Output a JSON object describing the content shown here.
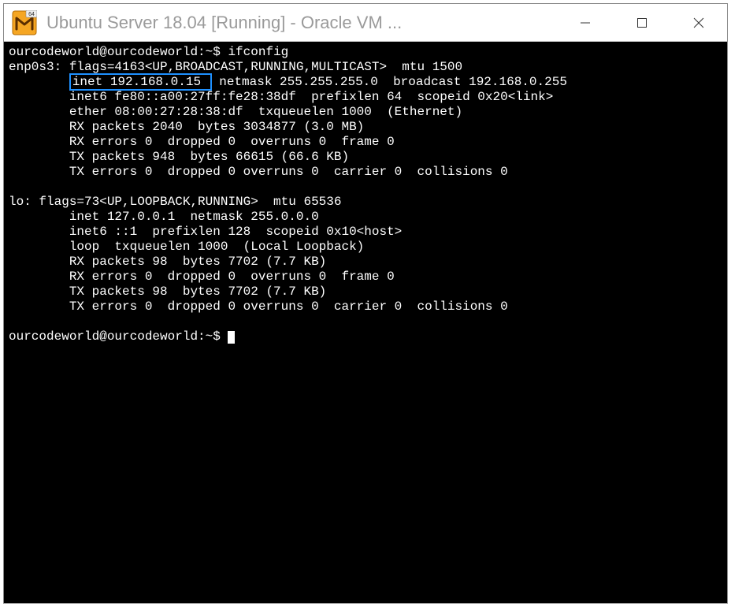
{
  "window": {
    "title": "Ubuntu Server 18.04 [Running] - Oracle VM ..."
  },
  "terminal": {
    "prompt1": "ourcodeworld@ourcodeworld:~$ ",
    "command1": "ifconfig",
    "iface1_head": "enp0s3: flags=4163<UP,BROADCAST,RUNNING,MULTICAST>  mtu 1500",
    "highlight": "inet 192.168.0.15 ",
    "after_highlight": " netmask 255.255.255.0  broadcast 192.168.0.255",
    "enp_inet6": "        inet6 fe80::a00:27ff:fe28:38df  prefixlen 64  scopeid 0x20<link>",
    "enp_ether": "        ether 08:00:27:28:38:df  txqueuelen 1000  (Ethernet)",
    "enp_rxp": "        RX packets 2040  bytes 3034877 (3.0 MB)",
    "enp_rxe": "        RX errors 0  dropped 0  overruns 0  frame 0",
    "enp_txp": "        TX packets 948  bytes 66615 (66.6 KB)",
    "enp_txe": "        TX errors 0  dropped 0 overruns 0  carrier 0  collisions 0",
    "lo_head": "lo: flags=73<UP,LOOPBACK,RUNNING>  mtu 65536",
    "lo_inet": "        inet 127.0.0.1  netmask 255.0.0.0",
    "lo_inet6": "        inet6 ::1  prefixlen 128  scopeid 0x10<host>",
    "lo_loop": "        loop  txqueuelen 1000  (Local Loopback)",
    "lo_rxp": "        RX packets 98  bytes 7702 (7.7 KB)",
    "lo_rxe": "        RX errors 0  dropped 0  overruns 0  frame 0",
    "lo_txp": "        TX packets 98  bytes 7702 (7.7 KB)",
    "lo_txe": "        TX errors 0  dropped 0 overruns 0  carrier 0  collisions 0",
    "prompt2": "ourcodeworld@ourcodeworld:~$ ",
    "indent": "        "
  }
}
